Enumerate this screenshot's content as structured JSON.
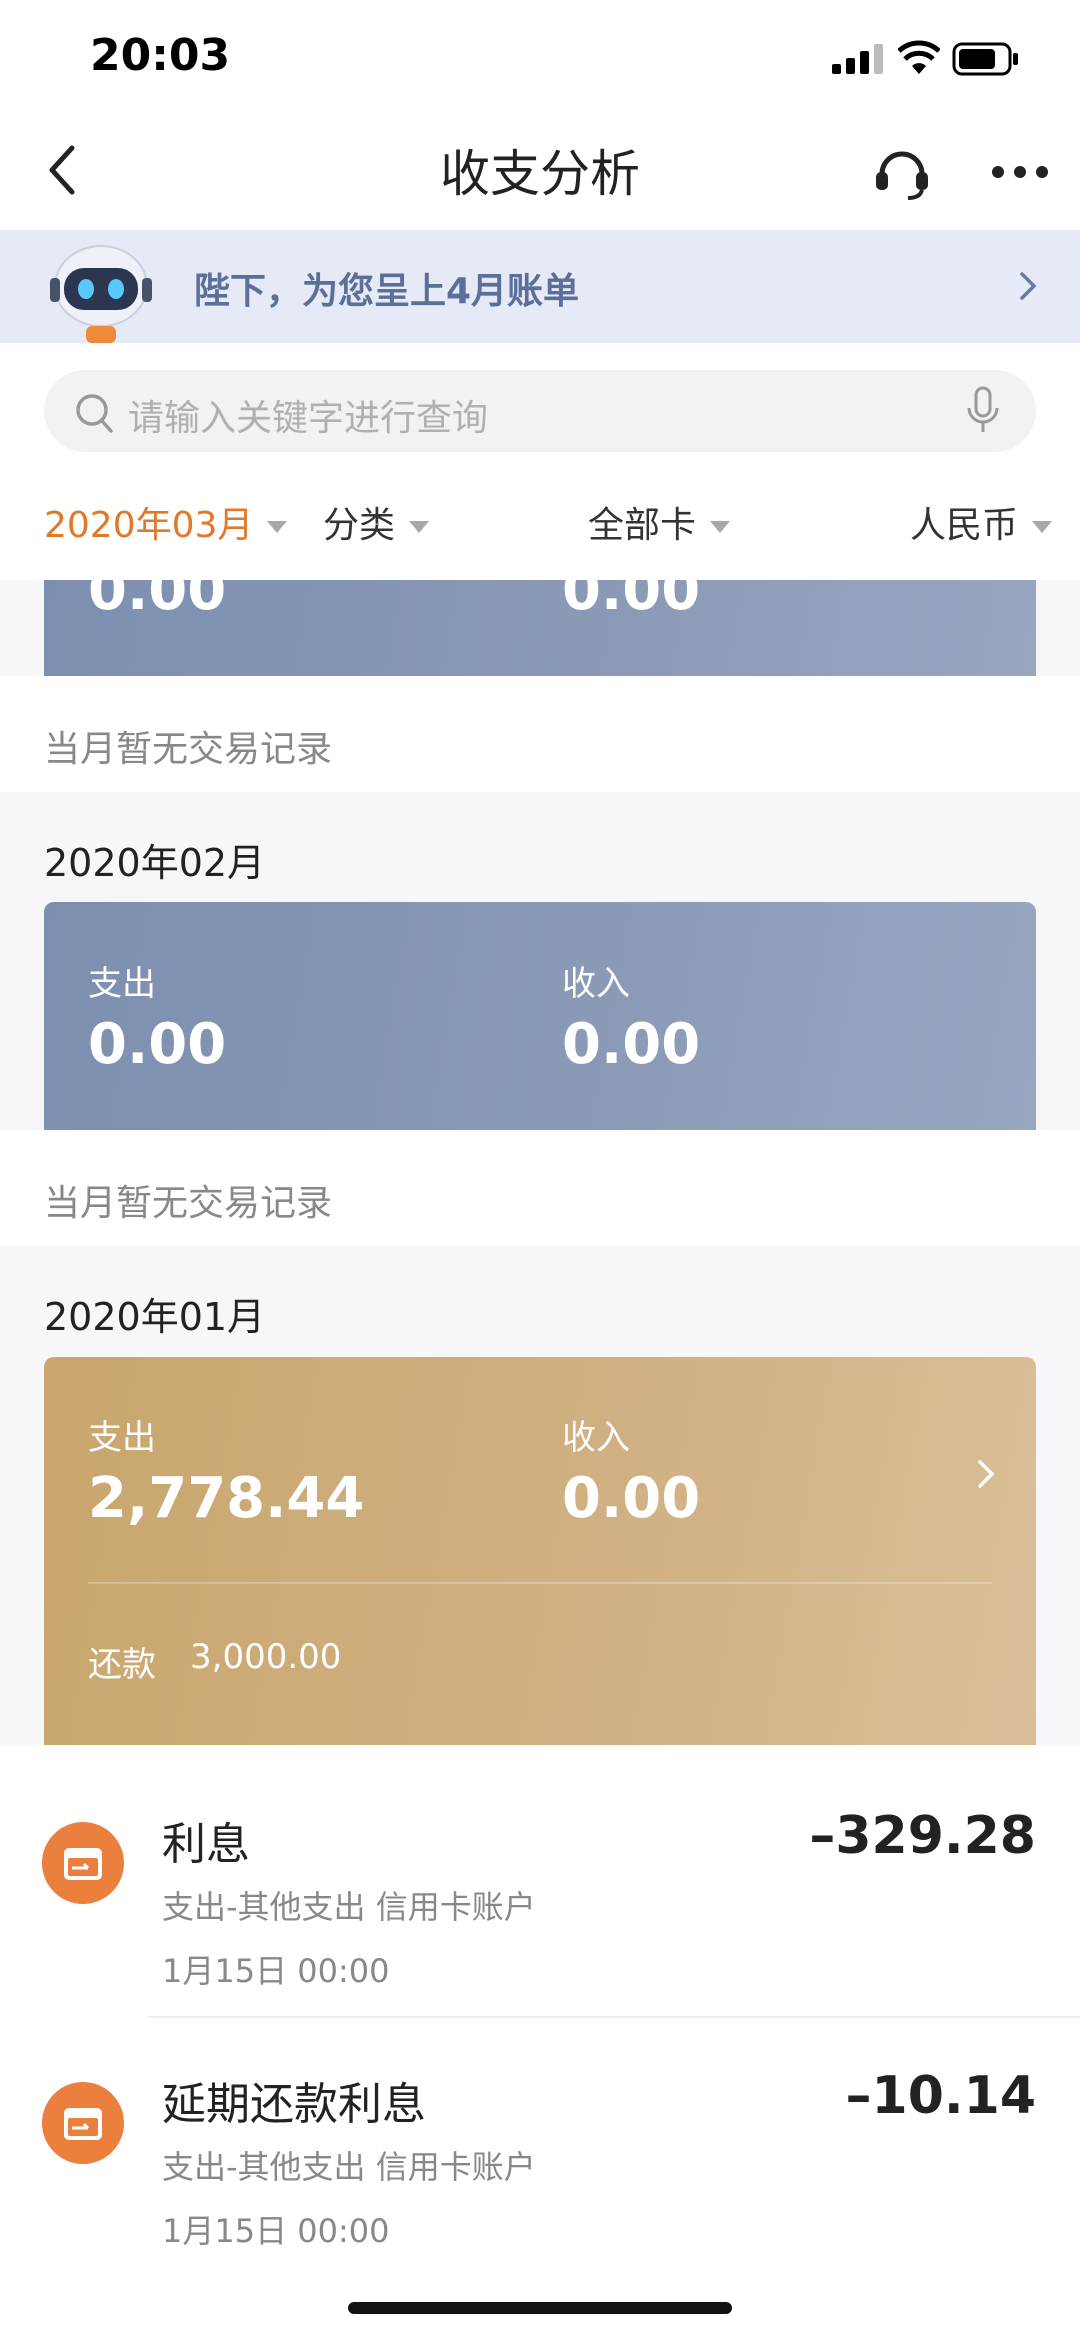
{
  "status_bar": {
    "time": "20:03"
  },
  "nav": {
    "title": "收支分析"
  },
  "banner": {
    "text": "陛下，为您呈上4月账单"
  },
  "search": {
    "placeholder": "请输入关键字进行查询"
  },
  "filters": [
    {
      "label": "2020年03月"
    },
    {
      "label": "分类"
    },
    {
      "label": "全部卡"
    },
    {
      "label": "人民币"
    }
  ],
  "months": [
    {
      "expense": "0.00",
      "income": "0.00",
      "no_record": "当月暂无交易记录"
    },
    {
      "month": "2020年02月",
      "expense_label": "支出",
      "expense": "0.00",
      "income_label": "收入",
      "income": "0.00",
      "no_record": "当月暂无交易记录"
    },
    {
      "month": "2020年01月",
      "expense_label": "支出",
      "expense": "2,778.44",
      "income_label": "收入",
      "income": "0.00",
      "repay_label": "还款",
      "repay": "3,000.00"
    }
  ],
  "transactions": [
    {
      "title": "利息",
      "category": "支出-其他支出 信用卡账户",
      "date": "1月15日 00:00",
      "amount": "–329.28"
    },
    {
      "title": "延期还款利息",
      "category": "支出-其他支出 信用卡账户",
      "date": "1月15日 00:00",
      "amount": "–10.14"
    }
  ],
  "colors": {
    "accent": "#e07a2a",
    "card_blue": "#8a9ab6",
    "card_gold": "#d0b082",
    "icon_orange": "#ea7f3e"
  }
}
